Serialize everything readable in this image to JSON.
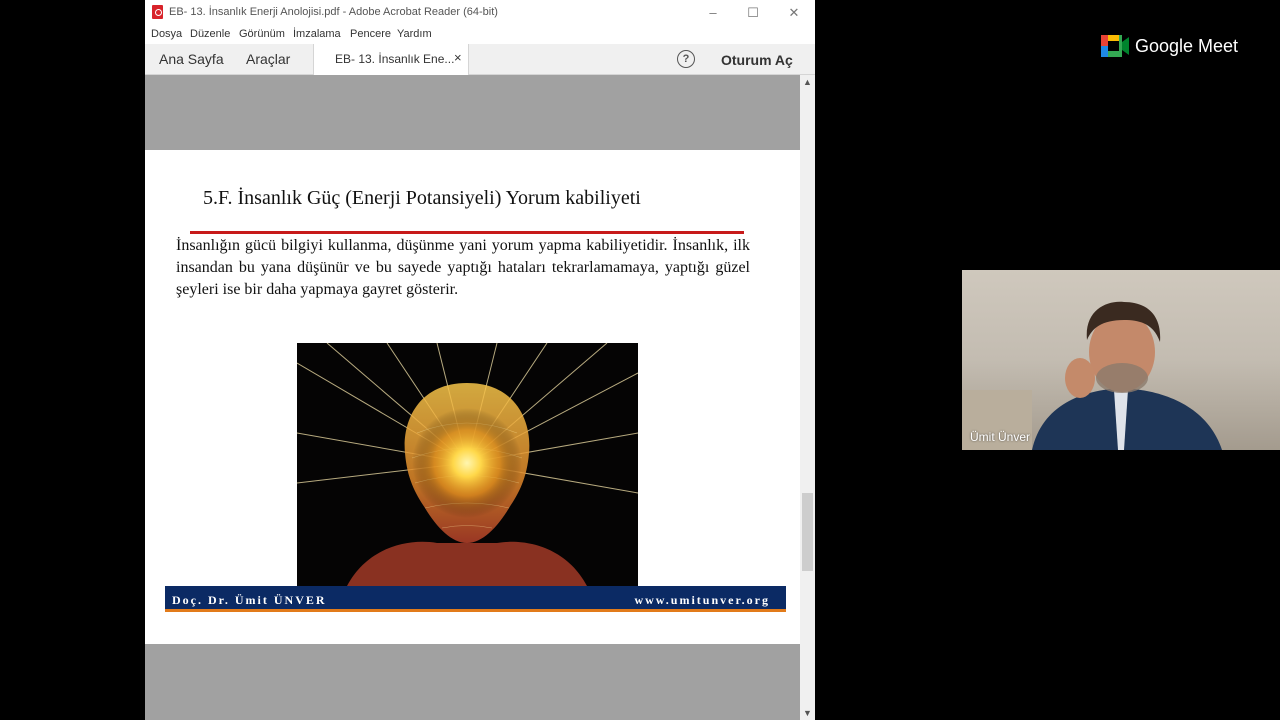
{
  "window": {
    "title": "EB- 13. İnsanlık Enerji Anolojisi.pdf - Adobe Acrobat Reader (64-bit)",
    "controls": {
      "minimize": "–",
      "maximize": "☐",
      "close": "✕"
    }
  },
  "menu": [
    "Dosya",
    "Düzenle",
    "Görünüm",
    "İmzalama",
    "Pencere",
    "Yardım"
  ],
  "tabs": {
    "home": "Ana Sayfa",
    "tools": "Araçlar",
    "document": "EB- 13. İnsanlık Ene...",
    "document_close": "×",
    "help": "?",
    "sign_in": "Oturum Aç"
  },
  "slide": {
    "title": "5.F. İnsanlık Güç (Enerji Potansiyeli) Yorum kabiliyeti",
    "body": "İnsanlığın gücü bilgiyi kullanma, düşünme yani yorum yapma kabiliyetidir. İnsanlık, ilk insandan bu yana düşünür ve bu sayede yaptığı hataları tekrarlamamaya, yaptığı güzel şeyleri ise bir daha yapmaya gayret gösterir.",
    "footer_author": "Doç. Dr. Ümit ÜNVER",
    "footer_site": "www.umitunver.org",
    "title_line_color": "#c71a1a",
    "footer_color": "#0b2a64",
    "footer_accent": "#e27b1a"
  },
  "scrollbar": {
    "up": "▲",
    "down": "▼"
  },
  "meet": {
    "brand": "Google Meet",
    "participant_name": "Ümit Ünver"
  }
}
